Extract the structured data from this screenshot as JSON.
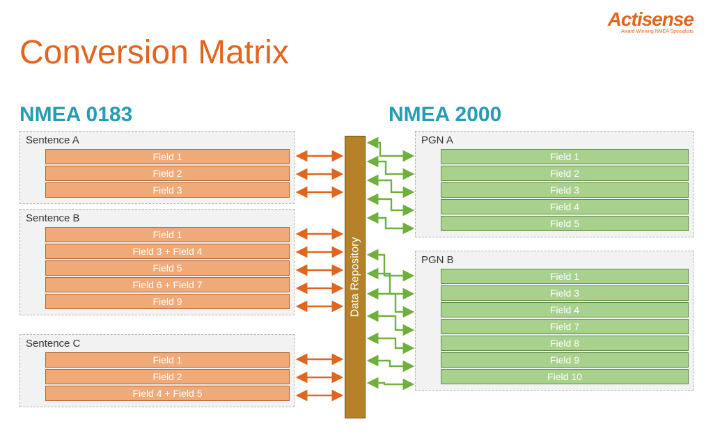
{
  "brand": {
    "name": "Actisense",
    "tagline": "Award Winning NMEA Specialists"
  },
  "title": "Conversion Matrix",
  "columns": {
    "left": "NMEA 0183",
    "right": "NMEA 2000"
  },
  "repository": "Data Repository",
  "left": {
    "sa": {
      "title": "Sentence A",
      "fields": [
        "Field 1",
        "Field 2",
        "Field 3"
      ]
    },
    "sb": {
      "title": "Sentence B",
      "fields": [
        "Field 1",
        "Field 3 + Field 4",
        "Field 5",
        "Field 6 + Field 7",
        "Field 9"
      ]
    },
    "sc": {
      "title": "Sentence C",
      "fields": [
        "Field 1",
        "Field 2",
        "Field 4 + Field 5"
      ]
    }
  },
  "right": {
    "pa": {
      "title": "PGN A",
      "fields": [
        "Field 1",
        "Field 2",
        "Field 3",
        "Field 4",
        "Field 5"
      ]
    },
    "pb": {
      "title": "PGN B",
      "fields": [
        "Field 1",
        "Field 3",
        "Field 4",
        "Field 7",
        "Field 8",
        "Field 9",
        "Field 10"
      ]
    }
  }
}
